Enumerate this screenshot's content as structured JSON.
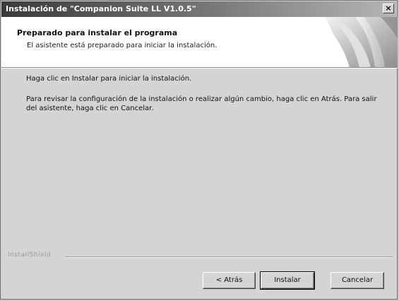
{
  "window": {
    "title": "Instalación de \"Companion Suite LL V1.0.5\"",
    "close_glyph": "×"
  },
  "header": {
    "title": "Preparado para instalar el programa",
    "subtitle": "El asistente está preparado para iniciar la instalación."
  },
  "body": {
    "line1": "Haga clic en Instalar para iniciar la instalación.",
    "line2": "Para revisar la configuración de la instalación o realizar algún cambio, haga clic en Atrás. Para salir del asistente, haga clic en Cancelar."
  },
  "footer": {
    "brand": "InstallShield",
    "back_label": "< Atrás",
    "install_label": "Instalar",
    "cancel_label": "Cancelar"
  },
  "colors": {
    "titlebar_start": "#3a3a3a",
    "titlebar_end": "#b6b6b6",
    "dialog_bg": "#d4d4d4",
    "header_bg": "#ffffff"
  },
  "icons": {
    "close": "close-icon",
    "header_art": "page-curl-icon"
  }
}
